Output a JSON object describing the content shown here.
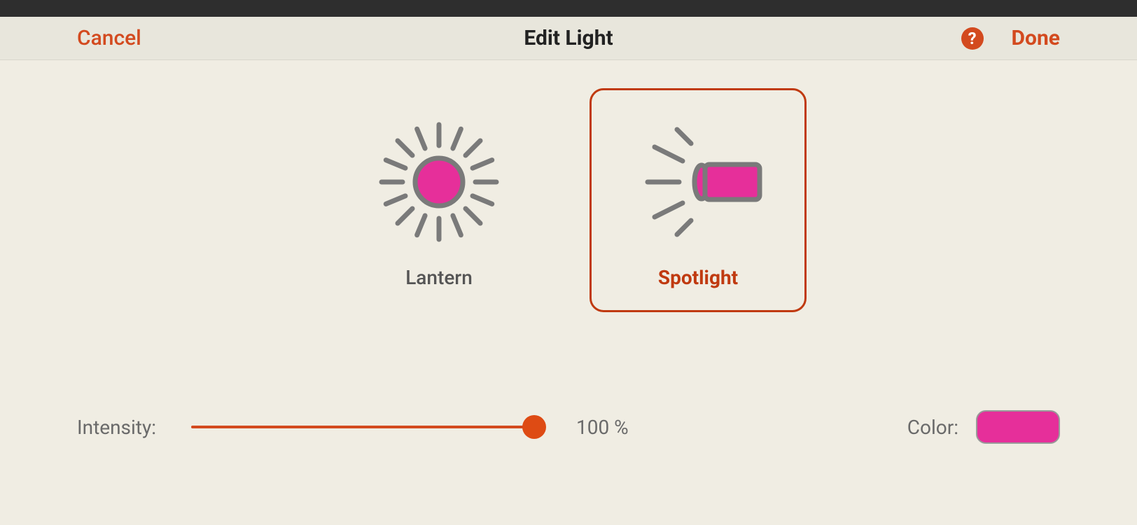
{
  "header": {
    "cancel_label": "Cancel",
    "title": "Edit Light",
    "done_label": "Done",
    "help_icon": "?"
  },
  "light_types": {
    "lantern": {
      "label": "Lantern",
      "selected": false
    },
    "spotlight": {
      "label": "Spotlight",
      "selected": true
    }
  },
  "intensity": {
    "label": "Intensity:",
    "value": 100,
    "value_display": "100 %"
  },
  "color": {
    "label": "Color:",
    "hex": "#e62f9a"
  },
  "accent_color": "#d34a1f"
}
